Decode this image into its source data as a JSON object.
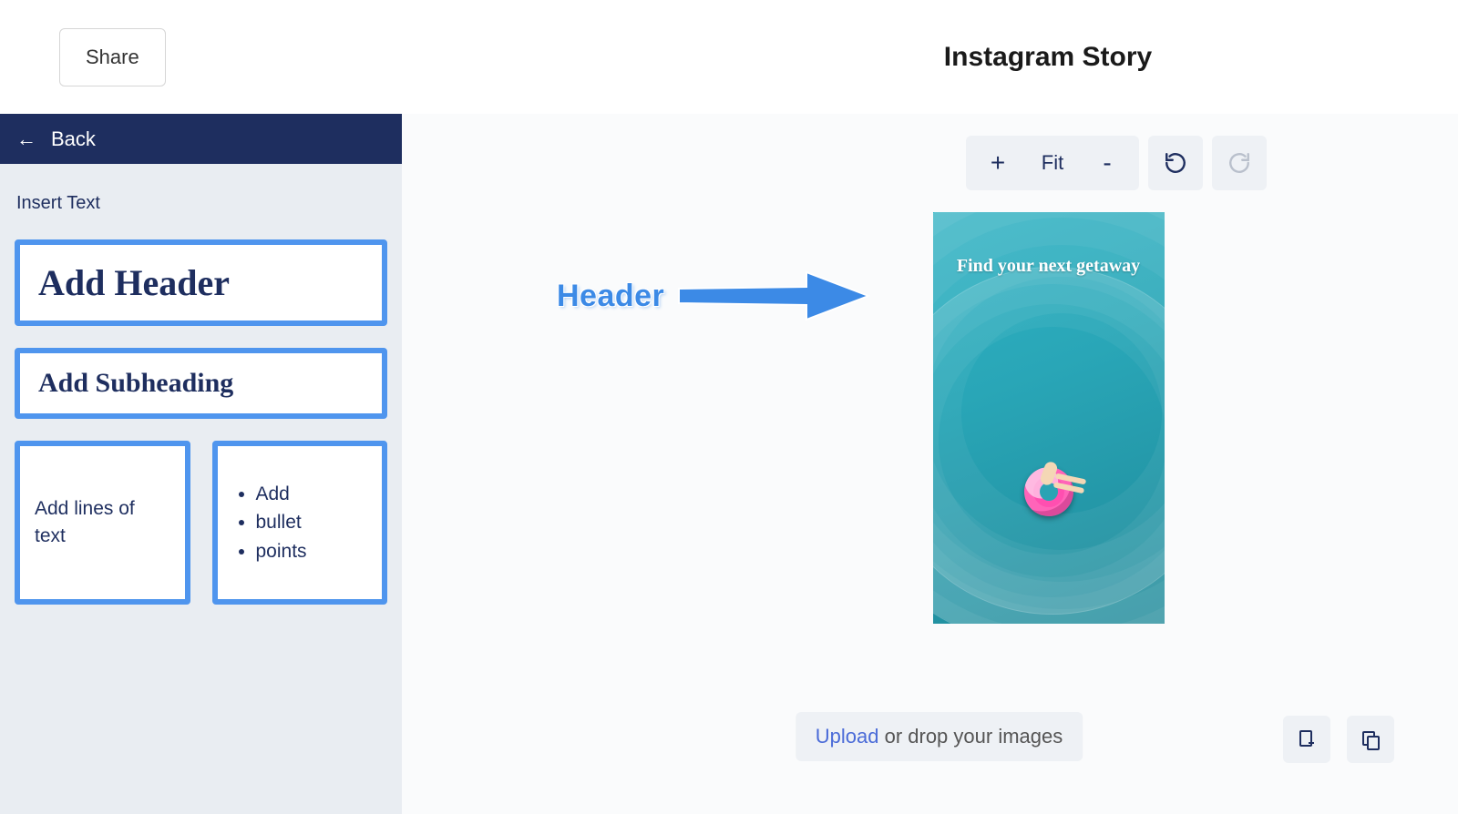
{
  "topbar": {
    "share_label": "Share",
    "document_title": "Instagram Story"
  },
  "sidebar": {
    "back_label": "Back",
    "section_label": "Insert Text",
    "options": {
      "header": "Add Header",
      "subheading": "Add Subheading",
      "lines": "Add lines of text",
      "bullets": [
        "Add",
        "bullet",
        "points"
      ]
    }
  },
  "toolbar": {
    "zoom_in": "+",
    "zoom_label": "Fit",
    "zoom_out": "-"
  },
  "canvas": {
    "headline": "Find your next getaway"
  },
  "annotation": {
    "label": "Header"
  },
  "upload": {
    "link": "Upload",
    "rest": " or drop your images"
  }
}
